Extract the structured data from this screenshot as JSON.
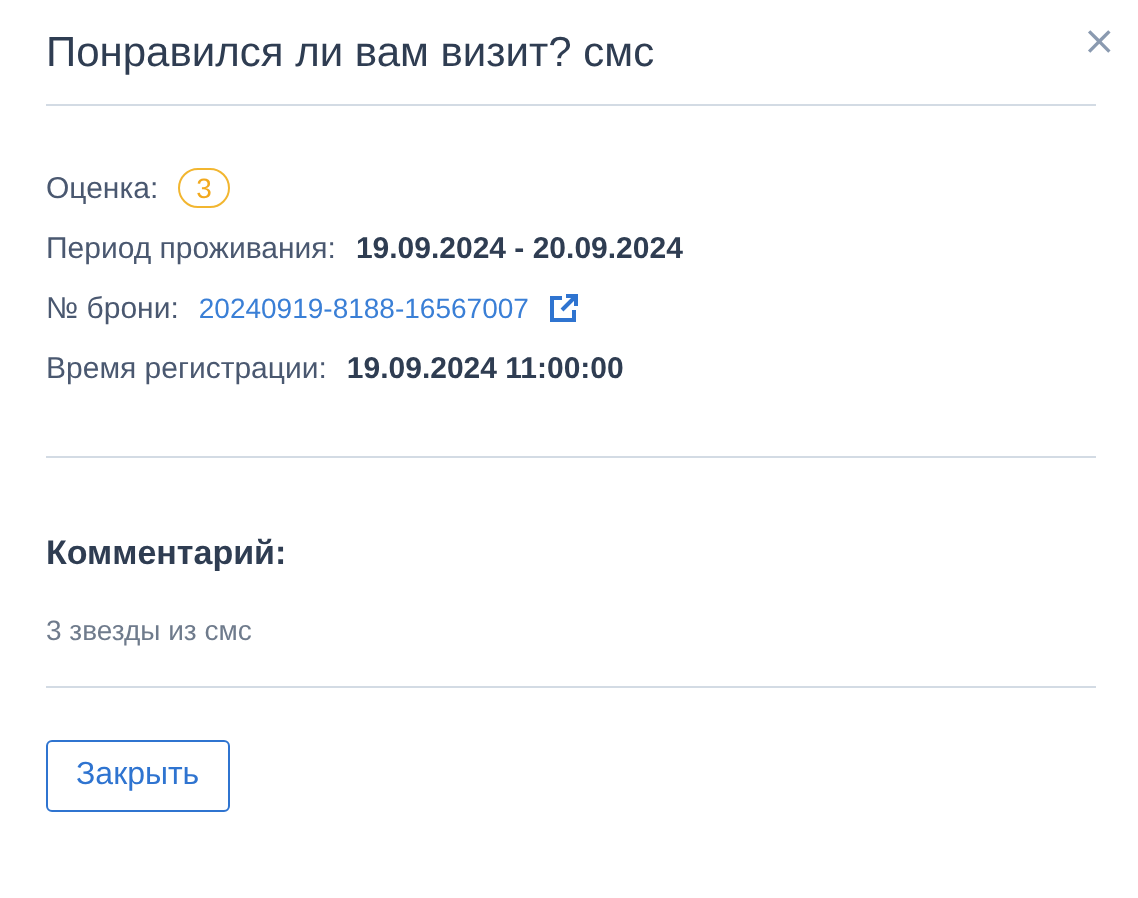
{
  "dialog": {
    "title": "Понравился ли вам визит? смс",
    "close": "×"
  },
  "fields": [
    {
      "kind": "badge",
      "label": "Оценка:",
      "value": "3"
    },
    {
      "kind": "bold",
      "label": "Период проживания:",
      "value": "19.09.2024 - 20.09.2024"
    },
    {
      "kind": "link",
      "label": "№ брони:",
      "value": "20240919-8188-16567007"
    },
    {
      "kind": "bold",
      "label": "Время регистрации:",
      "value": "19.09.2024 11:00:00"
    }
  ],
  "comment": {
    "heading": "Комментарий:",
    "text": "3 звезды из смс"
  },
  "buttons": [
    "Закрыть"
  ]
}
